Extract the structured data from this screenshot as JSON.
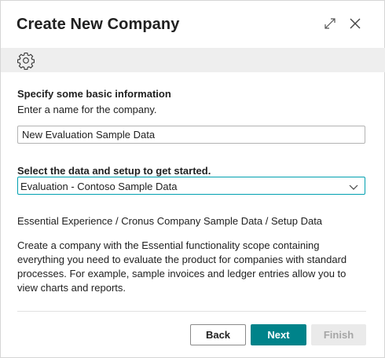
{
  "dialog": {
    "title": "Create New Company",
    "icons": {
      "expand": "expand-icon",
      "close": "close-icon",
      "settings": "gear-icon"
    }
  },
  "basic_info": {
    "heading": "Specify some basic information",
    "instruction": "Enter a name for the company.",
    "company_name_value": "New Evaluation Sample Data"
  },
  "data_setup": {
    "heading": "Select the data and setup to get started.",
    "selected_option": "Evaluation - Contoso Sample Data",
    "package_summary": "Essential Experience / Cronus Company Sample Data / Setup Data",
    "description": "Create a company with the Essential functionality scope containing everything you need to evaluate the product for companies with standard processes. For example, sample invoices and ledger entries allow you to view charts and reports."
  },
  "buttons": {
    "back": "Back",
    "next": "Next",
    "finish": "Finish"
  },
  "colors": {
    "accent": "#00838a",
    "focus_border": "#00a0b0",
    "action_bar_bg": "#eeeeee",
    "disabled_bg": "#eaeaea"
  }
}
